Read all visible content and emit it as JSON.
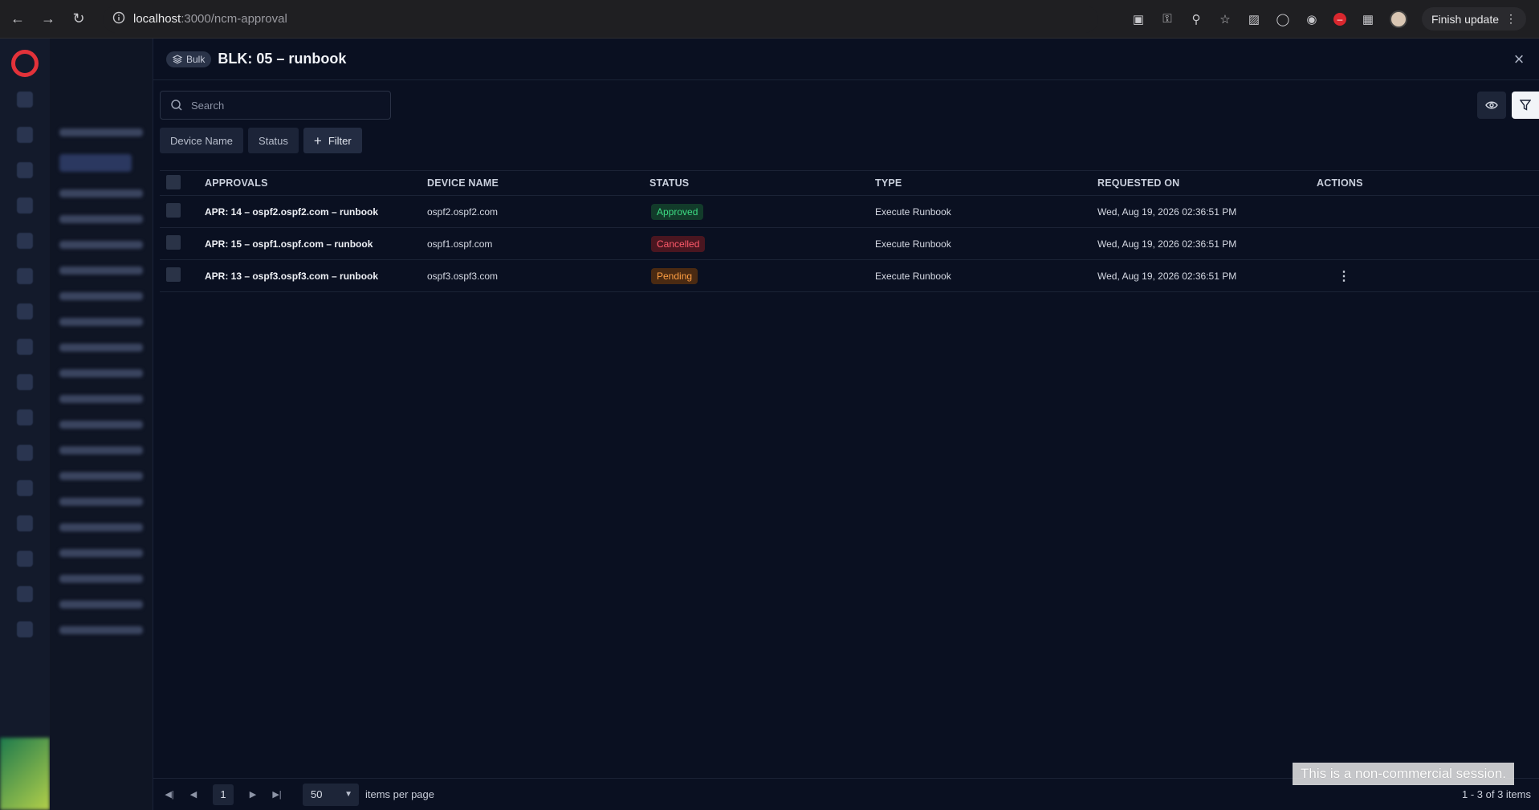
{
  "browser": {
    "url_host": "localhost",
    "url_path": ":3000/ncm-approval",
    "update_label": "Finish update"
  },
  "drawer": {
    "badge_label": "Bulk",
    "title": "BLK: 05 – runbook",
    "search_placeholder": "Search",
    "chips": [
      "Device Name",
      "Status"
    ],
    "add_filter_label": "Filter"
  },
  "table": {
    "headers": {
      "approvals": "APPROVALS",
      "device_name": "DEVICE NAME",
      "status": "STATUS",
      "type": "TYPE",
      "requested_on": "REQUESTED ON",
      "actions": "ACTIONS"
    },
    "rows": [
      {
        "approval": "APR: 14 – ospf2.ospf2.com – runbook",
        "device": "ospf2.ospf2.com",
        "status": "Approved",
        "type": "Execute Runbook",
        "requested_on": "Wed, Aug 19, 2026 02:36:51 PM",
        "has_actions": false
      },
      {
        "approval": "APR: 15 – ospf1.ospf.com – runbook",
        "device": "ospf1.ospf.com",
        "status": "Cancelled",
        "type": "Execute Runbook",
        "requested_on": "Wed, Aug 19, 2026 02:36:51 PM",
        "has_actions": false
      },
      {
        "approval": "APR: 13 – ospf3.ospf3.com – runbook",
        "device": "ospf3.ospf3.com",
        "status": "Pending",
        "type": "Execute Runbook",
        "requested_on": "Wed, Aug 19, 2026 02:36:51 PM",
        "has_actions": true
      }
    ]
  },
  "status_colors": {
    "Approved": {
      "bg": "#123b2a",
      "fg": "#3ddc84"
    },
    "Cancelled": {
      "bg": "#4a1620",
      "fg": "#ff5a6b"
    },
    "Pending": {
      "bg": "#4a2a12",
      "fg": "#ff9f43"
    }
  },
  "pagination": {
    "current_page": "1",
    "per_page": "50",
    "per_page_label": "items per page",
    "count_label": "1 - 3 of 3 items"
  },
  "watermark": "This is a non-commercial session."
}
